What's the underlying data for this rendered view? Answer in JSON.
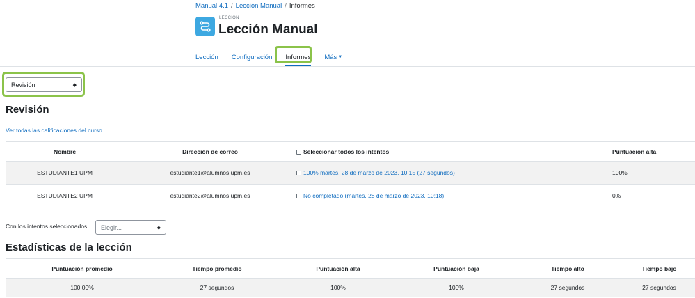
{
  "breadcrumb": {
    "items": [
      "Manual 4.1",
      "Lección Manual",
      "Informes"
    ],
    "separator": "/"
  },
  "module": {
    "kind": "LECCIÓN",
    "title": "Lección Manual",
    "icon": "lesson-icon",
    "icon_color": "#3da8e1"
  },
  "secondary_nav": {
    "tabs": [
      "Lección",
      "Configuración",
      "Informes",
      "Más"
    ],
    "active": "Informes"
  },
  "report_select": {
    "value": "Revisión"
  },
  "review": {
    "heading": "Revisión",
    "grades_link": "Ver todas las calificaciones del curso",
    "columns": [
      "Nombre",
      "Dirección de correo",
      "Seleccionar todos los intentos",
      "Puntuación alta"
    ],
    "rows": [
      {
        "name": "ESTUDIANTE1 UPM",
        "email": "estudiante1@alumnos.upm.es",
        "attempt": "100% martes, 28 de marzo de 2023, 10:15 (27 segundos)",
        "high": "100%"
      },
      {
        "name": "ESTUDIANTE2 UPM",
        "email": "estudiante2@alumnos.upm.es",
        "attempt": "No completado (martes, 28 de marzo de 2023, 10:18)",
        "high": "0%"
      }
    ]
  },
  "bulk": {
    "label": "Con los intentos seleccionados...",
    "placeholder": "Elegir..."
  },
  "stats": {
    "heading": "Estadísticas de la lección",
    "columns": [
      "Puntuación promedio",
      "Tiempo promedio",
      "Puntuación alta",
      "Puntuación baja",
      "Tiempo alto",
      "Tiempo bajo"
    ],
    "values": [
      "100,00%",
      "27 segundos",
      "100%",
      "100%",
      "27 segundos",
      "27 segundos"
    ]
  },
  "colors": {
    "link": "#0f6cbf",
    "highlight": "#8bc34a",
    "row_stripe": "#f2f2f2"
  }
}
